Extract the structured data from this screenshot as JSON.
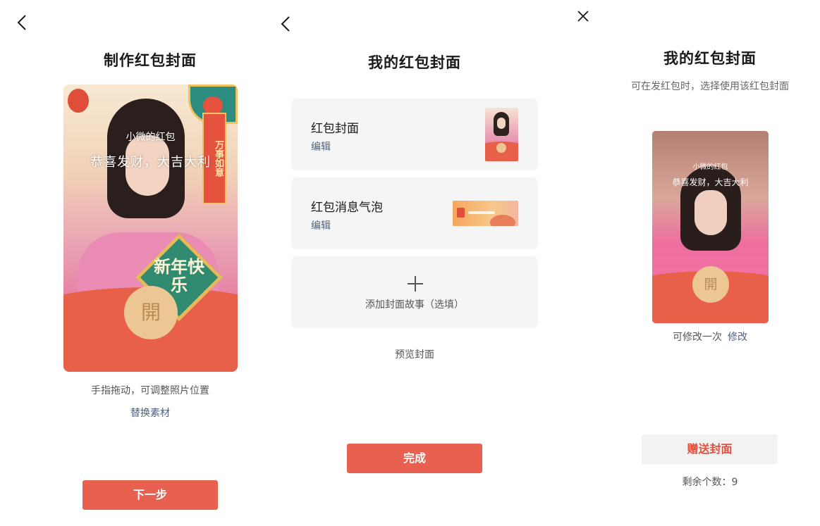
{
  "panel1": {
    "title": "制作红包封面",
    "cover": {
      "sender_name": "小微的红包",
      "blessing": "恭喜发财，大吉大利",
      "open_char": "開",
      "badge_text": "新年快乐",
      "banner_text": "万事如意"
    },
    "hint": "手指拖动，可调整照片位置",
    "replace_link": "替换素材",
    "next_button": "下一步"
  },
  "panel2": {
    "title": "我的红包封面",
    "cards": [
      {
        "title": "红包封面",
        "edit": "编辑"
      },
      {
        "title": "红包消息气泡",
        "edit": "编辑"
      }
    ],
    "add_story": "添加封面故事（选填）",
    "preview_link": "预览封面",
    "done_button": "完成"
  },
  "panel3": {
    "title": "我的红包封面",
    "subtitle": "可在发红包时，选择使用该红包封面",
    "cover": {
      "sender_name": "小微的红包",
      "blessing": "恭喜发财，大吉大利",
      "open_char": "開"
    },
    "modify_note": "可修改一次",
    "modify_link": "修改",
    "gift_button": "赠送封面",
    "remaining": "剩余个数：9"
  },
  "colors": {
    "primary_red": "#e8604f",
    "link_blue": "#51617d",
    "coin_gold": "#ecc794",
    "card_bg": "#f5f5f5"
  },
  "icons": {
    "back": "chevron-left-icon",
    "close": "close-icon",
    "add": "plus-icon"
  }
}
